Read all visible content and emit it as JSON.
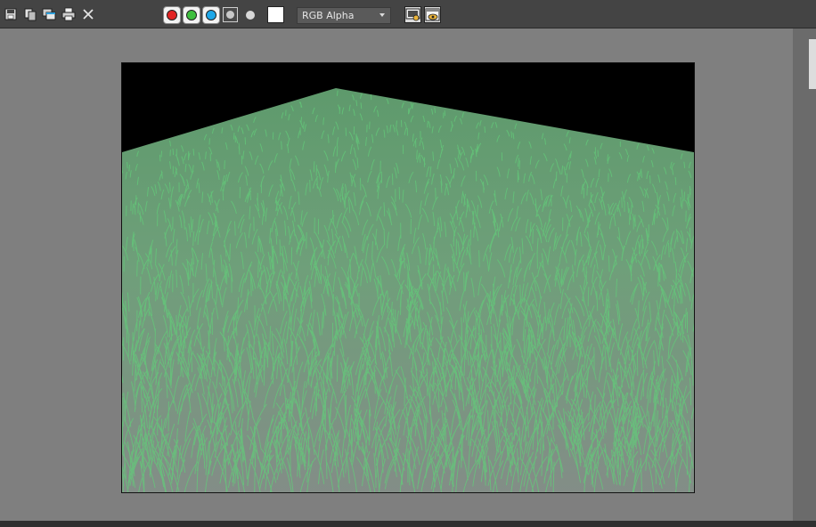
{
  "window": {
    "title": ""
  },
  "toolbar": {
    "buttons": [
      {
        "name": "save-image-button",
        "icon": "save-icon"
      },
      {
        "name": "copy-image-button",
        "icon": "copy-icon"
      },
      {
        "name": "clone-window-button",
        "icon": "clone-window-icon"
      },
      {
        "name": "print-button",
        "icon": "print-icon"
      },
      {
        "name": "clear-button",
        "icon": "close-icon"
      }
    ],
    "channels": [
      {
        "name": "red",
        "color": "#e22424"
      },
      {
        "name": "green",
        "color": "#3fbf3f"
      },
      {
        "name": "blue",
        "color": "#1ea7e8"
      }
    ],
    "swatch_color": "#ffffff",
    "channel_display": {
      "selected": "RGB Alpha"
    }
  },
  "render": {
    "background_color": "#000000",
    "grass_color": "#63c97a",
    "ground_color": "#8a948e"
  }
}
